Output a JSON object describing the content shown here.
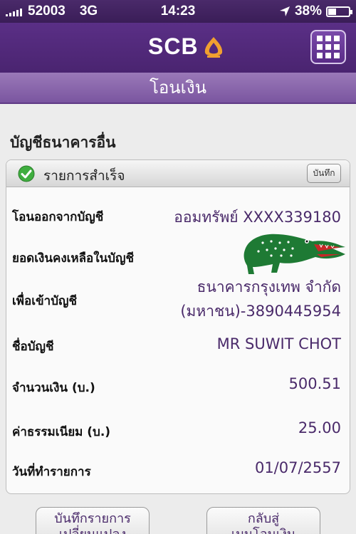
{
  "status_bar": {
    "carrier": "52003",
    "network": "3G",
    "time": "14:23",
    "battery": "38%",
    "battery_level": 0.38
  },
  "header": {
    "logo_text": "SCB",
    "page_title": "โอนเงิน"
  },
  "section": {
    "title": "บัญชีธนาคารอื่น"
  },
  "panel": {
    "status": "รายการสำเร็จ",
    "note_button": "บันทึก",
    "rows": [
      {
        "label": "โอนออกจากบัญชี",
        "value": "ออมทรัพย์ XXXX339180"
      },
      {
        "label": "ยอดเงินคงเหลือในบัญชี",
        "value": ""
      },
      {
        "label": "เพื่อเข้าบัญชี",
        "value_line1": "ธนาคารกรุงเทพ จำกัด",
        "value_line2": "(มหาชน)-3890445954"
      },
      {
        "label": "ชื่อบัญชี",
        "value": "MR SUWIT CHOT"
      },
      {
        "label": "จำนวนเงิน (บ.)",
        "value": "500.51"
      },
      {
        "label": "ค่าธรรมเนียม (บ.)",
        "value": "25.00"
      },
      {
        "label": "วันที่ทำรายการ",
        "value": "01/07/2557"
      }
    ]
  },
  "buttons": {
    "save_as_template": "บันทึกรายการ\nเปลี่ยนแปลง",
    "back": "กลับสู่\nเมนูโอนเงิน"
  },
  "colors": {
    "header": "#4a2470",
    "accent": "#f0a030",
    "value_text": "#4a2a6a"
  }
}
